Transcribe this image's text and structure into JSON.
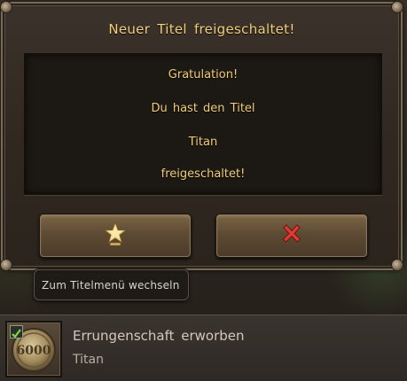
{
  "dialog": {
    "title": "Neuer Titel freigeschaltet!",
    "message_lines": [
      "Gratulation!",
      "Du hast den Titel",
      "Titan",
      "freigeschaltet!"
    ],
    "confirm_icon": "star-trophy-icon",
    "cancel_icon": "close-icon"
  },
  "tooltip": {
    "text": "Zum Titelmenü wechseln"
  },
  "notification": {
    "medal_value": "6000",
    "title": "Errungenschaft erworben",
    "subtitle": "Titan",
    "checked": true
  },
  "colors": {
    "title_text": "#f2ce7a",
    "cancel_x": "#e03b32",
    "star": "#f0d78c"
  }
}
